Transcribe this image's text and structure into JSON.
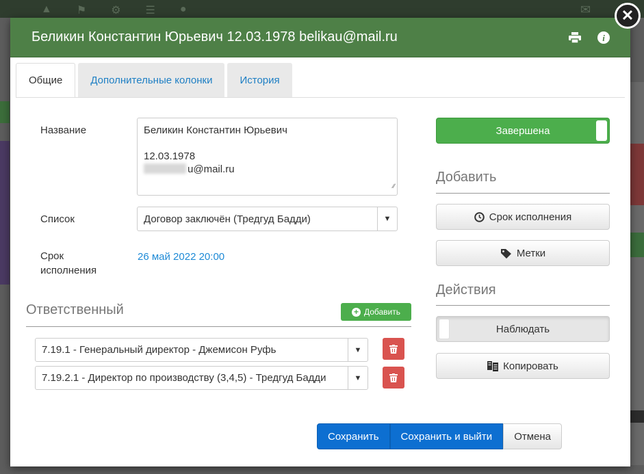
{
  "modal": {
    "title": "Беликин Константин Юрьевич 12.03.1978 belikau@mail.ru",
    "header_color": "#4e8047"
  },
  "tabs": [
    {
      "label": "Общие",
      "active": true
    },
    {
      "label": "Дополнительные колонки",
      "active": false
    },
    {
      "label": "История",
      "active": false
    }
  ],
  "form": {
    "name_label": "Название",
    "name_line1": "Беликин Константин Юрьевич",
    "name_line2": "12.03.1978",
    "name_line3_suffix": "u@mail.ru",
    "list_label": "Список",
    "list_value": "Договор заключён (Тредгуд Бадди)",
    "due_label_1": "Срок",
    "due_label_2": "исполнения",
    "due_value": "26 май 2022 20:00"
  },
  "responsible": {
    "title": "Ответственный",
    "add_label": "Добавить",
    "items": [
      "7.19.1 - Генеральный директор - Джемисон Руфь",
      "7.19.2.1 - Директор по производству (3,4,5) - Тредгуд Бадди"
    ]
  },
  "side": {
    "status_label": "Завершена",
    "status_color": "#4cae4c",
    "add_section": "Добавить",
    "due_button": "Срок исполнения",
    "tags_button": "Метки",
    "actions_section": "Действия",
    "watch_button": "Наблюдать",
    "copy_button": "Копировать"
  },
  "footer": {
    "save": "Сохранить",
    "save_exit": "Сохранить и выйти",
    "cancel": "Отмена"
  },
  "icons": {
    "close": "close-icon",
    "print": "print-icon",
    "info": "info-icon"
  }
}
